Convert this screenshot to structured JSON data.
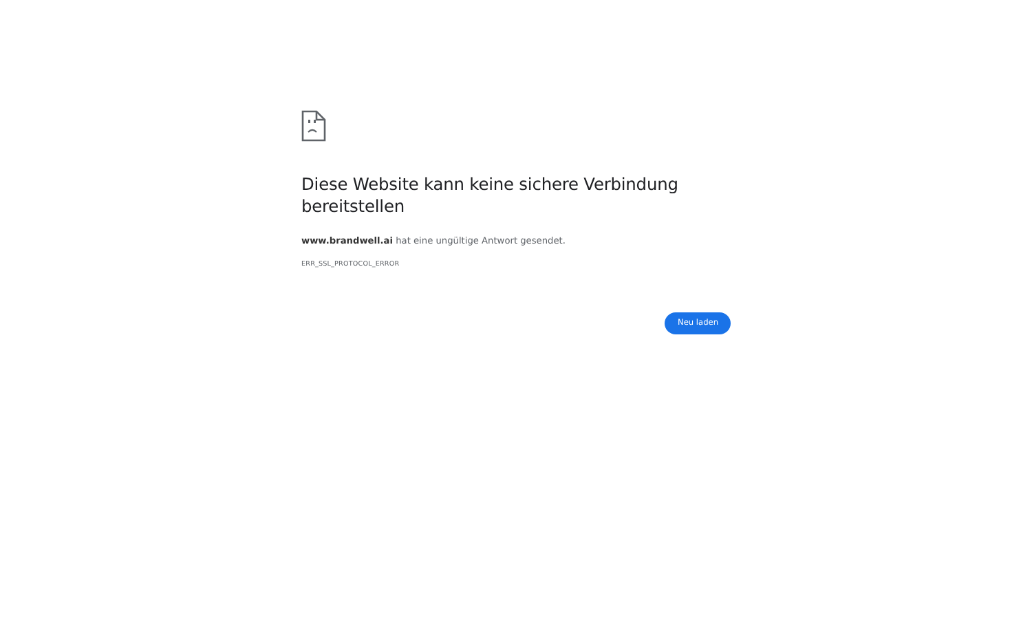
{
  "error_page": {
    "heading": "Diese Website kann keine sichere Verbindung bereitstellen",
    "message": "**www.brandwell.ai** hat eine ungültige Antwort gesendet.",
    "error_code": "ERR_SSL_PROTOCOL_ERROR",
    "buttons": [
      "Neu laden"
    ]
  }
}
